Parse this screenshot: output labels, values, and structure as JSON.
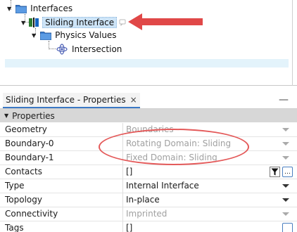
{
  "tree": {
    "items": [
      {
        "label": "Interfaces"
      },
      {
        "label": "Sliding Interface"
      },
      {
        "label": "Physics Values"
      },
      {
        "label": "Intersection"
      }
    ]
  },
  "panel": {
    "tab_title": "Sliding Interface - Properties",
    "close_glyph": "×",
    "minimize_glyph": "—"
  },
  "properties": {
    "section_title": "Properties",
    "rows": [
      {
        "name": "Geometry",
        "value": "Boundaries"
      },
      {
        "name": "Boundary-0",
        "value": "Rotating Domain: Sliding"
      },
      {
        "name": "Boundary-1",
        "value": "Fixed Domain: Sliding"
      },
      {
        "name": "Contacts",
        "value": "[]"
      },
      {
        "name": "Type",
        "value": "Internal Interface"
      },
      {
        "name": "Topology",
        "value": "In-place"
      },
      {
        "name": "Connectivity",
        "value": "Imprinted"
      },
      {
        "name": "Tags",
        "value": "[]"
      }
    ]
  },
  "colors": {
    "annotation": "#e04848",
    "selection": "#cde4f7"
  }
}
